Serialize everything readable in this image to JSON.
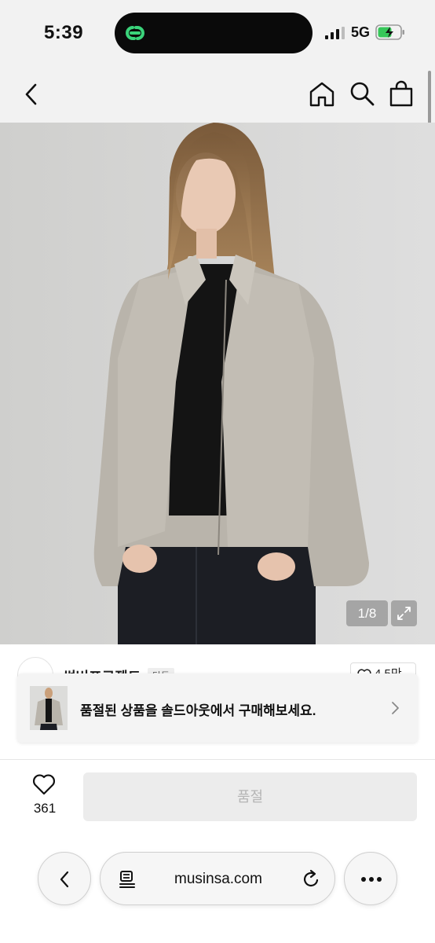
{
  "status_bar": {
    "time": "5:39",
    "network": "5G"
  },
  "product": {
    "image_counter": "1/8",
    "brand_name": "썸버프로젝트",
    "brand_tag": "단독",
    "brand_likes": "4.5만"
  },
  "banner": {
    "text": "품절된 상품을 솔드아웃에서 구매해보세요."
  },
  "buy_bar": {
    "like_count": "361",
    "soldout_label": "품절"
  },
  "browser": {
    "url": "musinsa.com"
  },
  "colors": {
    "accent_green": "#3ad37a",
    "page_bg": "#f2f2f2",
    "disabled_text": "#b5b5b5"
  }
}
